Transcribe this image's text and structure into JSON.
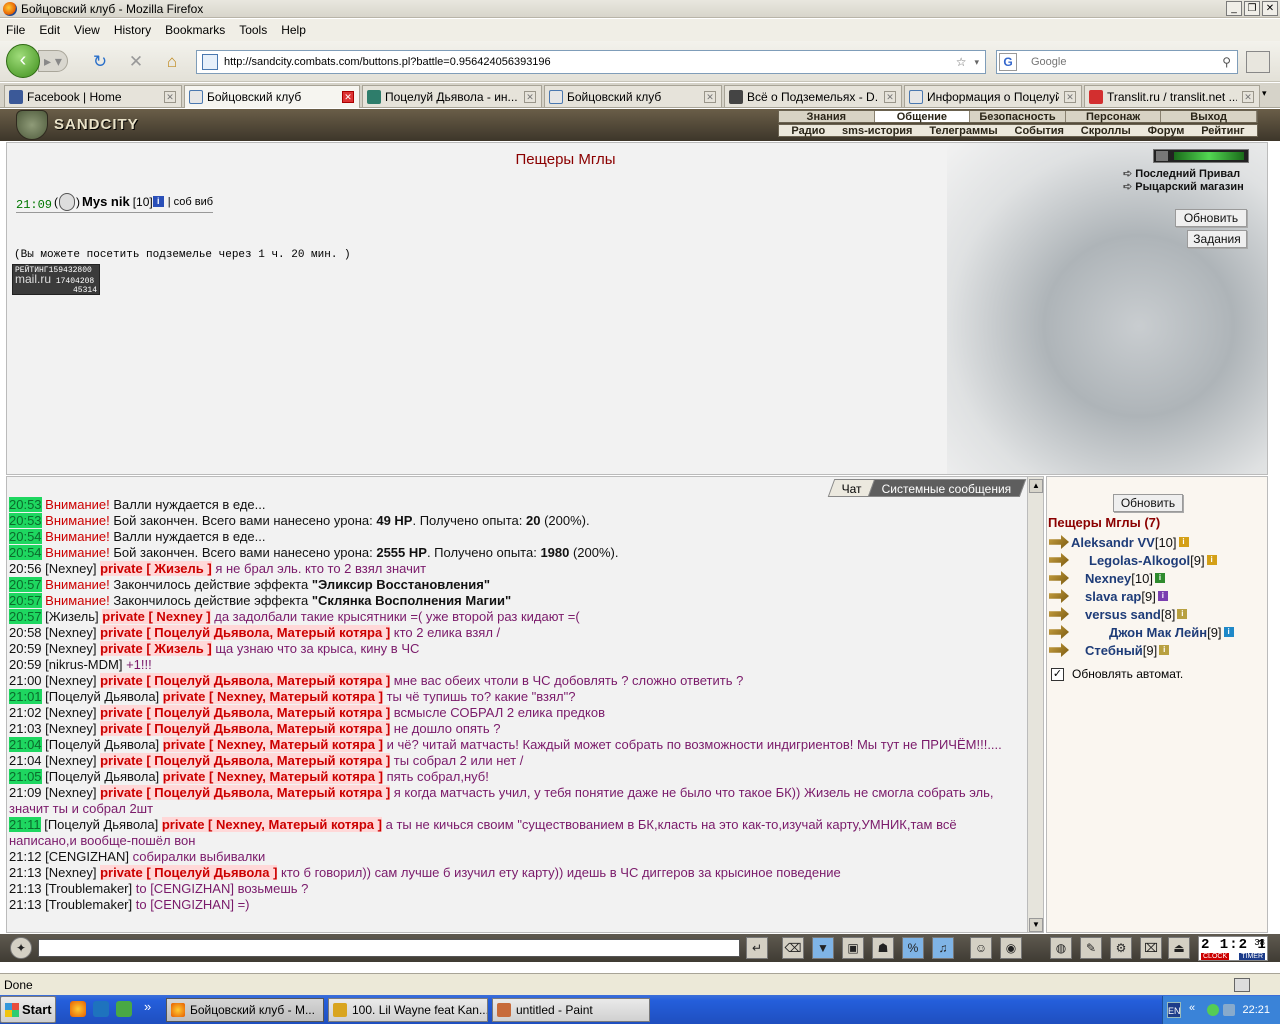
{
  "window": {
    "title": "Бойцовский клуб - Mozilla Firefox"
  },
  "menu": [
    "File",
    "Edit",
    "View",
    "History",
    "Bookmarks",
    "Tools",
    "Help"
  ],
  "url": "http://sandcity.combats.com/buttons.pl?battle=0.956424056393196",
  "search_placeholder": "Google",
  "tabs": [
    {
      "label": "Facebook | Home",
      "color": "#3b5998"
    },
    {
      "label": "Бойцовский клуб",
      "color": "#e6e6e6",
      "active": true
    },
    {
      "label": "Поцелуй Дьявола - ин...",
      "color": "#2e7d6b"
    },
    {
      "label": "Бойцовский клуб",
      "color": "#e6e6e6"
    },
    {
      "label": "Всё о Подземельях - D...",
      "color": "#444444"
    },
    {
      "label": "Информация о Поцелуй...",
      "color": "#e6e6e6"
    },
    {
      "label": "Translit.ru / translit.net ...",
      "color": "#d32f2f"
    }
  ],
  "game": {
    "logo": "SANDCITY",
    "menu_top": [
      "Знания",
      "Общение",
      "Безопасность",
      "Персонаж",
      "Выход"
    ],
    "menu_bottom": [
      "Радио",
      "sms-история",
      "Телеграммы",
      "События",
      "Скроллы",
      "Форум",
      "Рейтинг"
    ],
    "location_title": "Пещеры Мглы",
    "player": {
      "time": "21:09",
      "name": "Mys nik",
      "level": "[10]",
      "suffix": "| соб виб"
    },
    "visit_note": "(Вы можете посетить подземелье через 1 ч. 20 мин. )",
    "mailru": {
      "label": "РЕЙТИНГ",
      "n1": "159432800",
      "logo": "mail.ru",
      "n2": "17404208",
      "n3": "45314"
    },
    "side_links": [
      "Последний Привал",
      "Рыцарский магазин"
    ],
    "btn_refresh": "Обновить",
    "btn_tasks": "Задания",
    "chat_tabs": [
      "Чат",
      "Системные сообщения"
    ]
  },
  "chat": [
    {
      "time": "20:53",
      "hl": true,
      "parts": [
        {
          "t": "Внимание!",
          "c": "warn"
        },
        {
          "t": " Валли нуждается в еде...",
          "c": "sys"
        }
      ]
    },
    {
      "time": "20:53",
      "hl": true,
      "parts": [
        {
          "t": "Внимание!",
          "c": "warn"
        },
        {
          "t": " Бой закончен. Всего вами нанесено урона: ",
          "c": "sys"
        },
        {
          "t": "49 HP",
          "c": "bl"
        },
        {
          "t": ". Получено опыта: ",
          "c": "sys"
        },
        {
          "t": "20",
          "c": "bl"
        },
        {
          "t": " (200%).",
          "c": "sys"
        }
      ]
    },
    {
      "time": "20:54",
      "hl": true,
      "parts": [
        {
          "t": "Внимание!",
          "c": "warn"
        },
        {
          "t": " Валли нуждается в еде...",
          "c": "sys"
        }
      ]
    },
    {
      "time": "20:54",
      "hl": true,
      "parts": [
        {
          "t": "Внимание!",
          "c": "warn"
        },
        {
          "t": " Бой закончен. Всего вами нанесено урона: ",
          "c": "sys"
        },
        {
          "t": "2555 HP",
          "c": "bl"
        },
        {
          "t": ". Получено опыта: ",
          "c": "sys"
        },
        {
          "t": "1980",
          "c": "bl"
        },
        {
          "t": " (200%).",
          "c": "sys"
        }
      ]
    },
    {
      "time": "20:56",
      "hl": false,
      "parts": [
        {
          "t": "[Nexney] ",
          "c": "nk"
        },
        {
          "t": "private [ Жизель ]",
          "c": "pv"
        },
        {
          "t": " я не брал эль. кто то 2 взял значит",
          "c": "ms"
        }
      ]
    },
    {
      "time": "20:57",
      "hl": true,
      "parts": [
        {
          "t": "Внимание!",
          "c": "warn"
        },
        {
          "t": " Закончилось действие эффекта ",
          "c": "sys"
        },
        {
          "t": "\"Эликсир Восстановления\"",
          "c": "bl"
        }
      ]
    },
    {
      "time": "20:57",
      "hl": true,
      "parts": [
        {
          "t": "Внимание!",
          "c": "warn"
        },
        {
          "t": " Закончилось действие эффекта ",
          "c": "sys"
        },
        {
          "t": "\"Склянка Восполнения Магии\"",
          "c": "bl"
        }
      ]
    },
    {
      "time": "20:57",
      "hl": true,
      "parts": [
        {
          "t": "[Жизель] ",
          "c": "nk"
        },
        {
          "t": "private [ Nexney ]",
          "c": "pv"
        },
        {
          "t": " да задолбали такие крысятники =( уже второй раз кидают =(",
          "c": "ms"
        }
      ]
    },
    {
      "time": "20:58",
      "hl": false,
      "parts": [
        {
          "t": "[Nexney] ",
          "c": "nk"
        },
        {
          "t": "private [ Поцелуй Дьявола, Матерый котяра ]",
          "c": "pv"
        },
        {
          "t": " кто 2 елика взял /",
          "c": "ms"
        }
      ]
    },
    {
      "time": "20:59",
      "hl": false,
      "parts": [
        {
          "t": "[Nexney] ",
          "c": "nk"
        },
        {
          "t": "private [ Жизель ]",
          "c": "pv"
        },
        {
          "t": " ща узнаю что за крыса, кину в ЧС",
          "c": "ms"
        }
      ]
    },
    {
      "time": "20:59",
      "hl": false,
      "parts": [
        {
          "t": "[nikrus-MDM] ",
          "c": "nk"
        },
        {
          "t": "+1!!!",
          "c": "ms"
        }
      ]
    },
    {
      "time": "21:00",
      "hl": false,
      "parts": [
        {
          "t": "[Nexney] ",
          "c": "nk"
        },
        {
          "t": "private [ Поцелуй Дьявола, Матерый котяра ]",
          "c": "pv"
        },
        {
          "t": " мне вас обеих чтоли в ЧС добовлять ? сложно ответить ?",
          "c": "ms"
        }
      ]
    },
    {
      "time": "21:01",
      "hl": true,
      "parts": [
        {
          "t": "[Поцелуй Дьявола] ",
          "c": "nk"
        },
        {
          "t": "private [ Nexney, Матерый котяра ]",
          "c": "pv"
        },
        {
          "t": " ты чё тупишь то? какие \"взял\"?",
          "c": "ms"
        }
      ]
    },
    {
      "time": "21:02",
      "hl": false,
      "parts": [
        {
          "t": "[Nexney] ",
          "c": "nk"
        },
        {
          "t": "private [ Поцелуй Дьявола, Матерый котяра ]",
          "c": "pv"
        },
        {
          "t": " всмысле СОБРАЛ 2 елика предков",
          "c": "ms"
        }
      ]
    },
    {
      "time": "21:03",
      "hl": false,
      "parts": [
        {
          "t": "[Nexney] ",
          "c": "nk"
        },
        {
          "t": "private [ Поцелуй Дьявола, Матерый котяра ]",
          "c": "pv"
        },
        {
          "t": " не дошло опять ?",
          "c": "ms"
        }
      ]
    },
    {
      "time": "21:04",
      "hl": true,
      "parts": [
        {
          "t": "[Поцелуй Дьявола] ",
          "c": "nk"
        },
        {
          "t": "private [ Nexney, Матерый котяра ]",
          "c": "pv"
        },
        {
          "t": " и чё? читай матчасть! Каждый может собрать по возможности индигриентов! Мы тут не ПРИЧЁМ!!!....",
          "c": "ms"
        }
      ]
    },
    {
      "time": "21:04",
      "hl": false,
      "parts": [
        {
          "t": "[Nexney] ",
          "c": "nk"
        },
        {
          "t": "private [ Поцелуй Дьявола, Матерый котяра ]",
          "c": "pv"
        },
        {
          "t": " ты собрал 2 или нет /",
          "c": "ms"
        }
      ]
    },
    {
      "time": "21:05",
      "hl": true,
      "parts": [
        {
          "t": "[Поцелуй Дьявола] ",
          "c": "nk"
        },
        {
          "t": "private [ Nexney, Матерый котяра ]",
          "c": "pv"
        },
        {
          "t": " пять собрал,нуб!",
          "c": "ms"
        }
      ]
    },
    {
      "time": "21:09",
      "hl": false,
      "parts": [
        {
          "t": "[Nexney] ",
          "c": "nk"
        },
        {
          "t": "private [ Поцелуй Дьявола, Матерый котяра ]",
          "c": "pv"
        },
        {
          "t": " я когда матчасть учил, у тебя понятие даже не было что такое БК)) Жизель не смогла собрать эль, значит ты и собрал 2шт",
          "c": "ms"
        }
      ]
    },
    {
      "time": "21:11",
      "hl": true,
      "parts": [
        {
          "t": "[Поцелуй Дьявола] ",
          "c": "nk"
        },
        {
          "t": "private [ Nexney, Матерый котяра ]",
          "c": "pv"
        },
        {
          "t": " а ты не кичься своим \"существованием в БК,класть на это как-то,изучай карту,УМНИК,там всё написано,и вообще-пошёл вон",
          "c": "ms"
        }
      ]
    },
    {
      "time": "21:12",
      "hl": false,
      "parts": [
        {
          "t": "[CENGIZHAN] ",
          "c": "nk"
        },
        {
          "t": "собиралки выбивалки",
          "c": "ms"
        }
      ]
    },
    {
      "time": "21:13",
      "hl": false,
      "parts": [
        {
          "t": "[Nexney] ",
          "c": "nk"
        },
        {
          "t": "private [ Поцелуй Дьявола ]",
          "c": "pv"
        },
        {
          "t": " кто б говорил)) сам лучше б изучил ету карту)) идешь в ЧС диггеров за крысиное поведение",
          "c": "ms"
        }
      ]
    },
    {
      "time": "21:13",
      "hl": false,
      "parts": [
        {
          "t": "[Troublemaker] ",
          "c": "nk"
        },
        {
          "t": "to [CENGIZHAN] возьмешь ?",
          "c": "ms"
        }
      ]
    },
    {
      "time": "21:13",
      "hl": false,
      "parts": [
        {
          "t": "[Troublemaker] ",
          "c": "nk"
        },
        {
          "t": "to [CENGIZHAN] =)",
          "c": "ms"
        }
      ]
    }
  ],
  "players_panel": {
    "refresh": "Обновить",
    "location": "Пещеры Мглы (7)",
    "players": [
      {
        "name": "Aleksandr VV",
        "level": "[10]",
        "inf": "#d4a017"
      },
      {
        "name": "Legolas-Alkogol",
        "level": "[9]",
        "inf": "#d4a017"
      },
      {
        "name": "Nexney",
        "level": "[10]",
        "inf": "#2e8b2e"
      },
      {
        "name": "slava rap",
        "level": "[9]",
        "inf": "#7a3fb0"
      },
      {
        "name": "versus sand",
        "level": "[8]",
        "inf": "#b8a040"
      },
      {
        "name": "Джон Мак Лейн",
        "level": "[9]",
        "inf": "#1e88c8"
      },
      {
        "name": "Стебный",
        "level": "[9]",
        "inf": "#b8a040"
      }
    ],
    "auto_refresh": "Обновлять автомат."
  },
  "clock": {
    "digits": "2 1:2 1",
    "sec": "38",
    "clock": "CLOCK",
    "timer": "TIMER"
  },
  "status": "Done",
  "taskbar": {
    "start": "Start",
    "tasks": [
      "Бойцовский клуб - M...",
      "100. Lil Wayne feat Kan...",
      "untitled - Paint"
    ],
    "lang": "EN",
    "time": "22:21"
  }
}
